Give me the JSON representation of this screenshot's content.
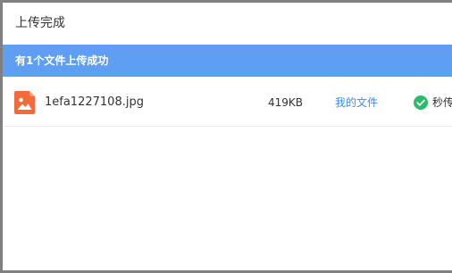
{
  "dialog": {
    "title": "上传完成"
  },
  "banner": {
    "message": "有1个文件上传成功"
  },
  "files": [
    {
      "icon": "image-file-icon",
      "name": "1efa1227108.jpg",
      "size": "419KB",
      "link": "我的文件",
      "status": "秒传",
      "status_icon": "check-circle-icon"
    }
  ],
  "colors": {
    "banner": "#5f9ff3",
    "link": "#3b8cf0",
    "success": "#2dbb6b",
    "file_icon": "#f36b3a",
    "border": "#808080"
  }
}
